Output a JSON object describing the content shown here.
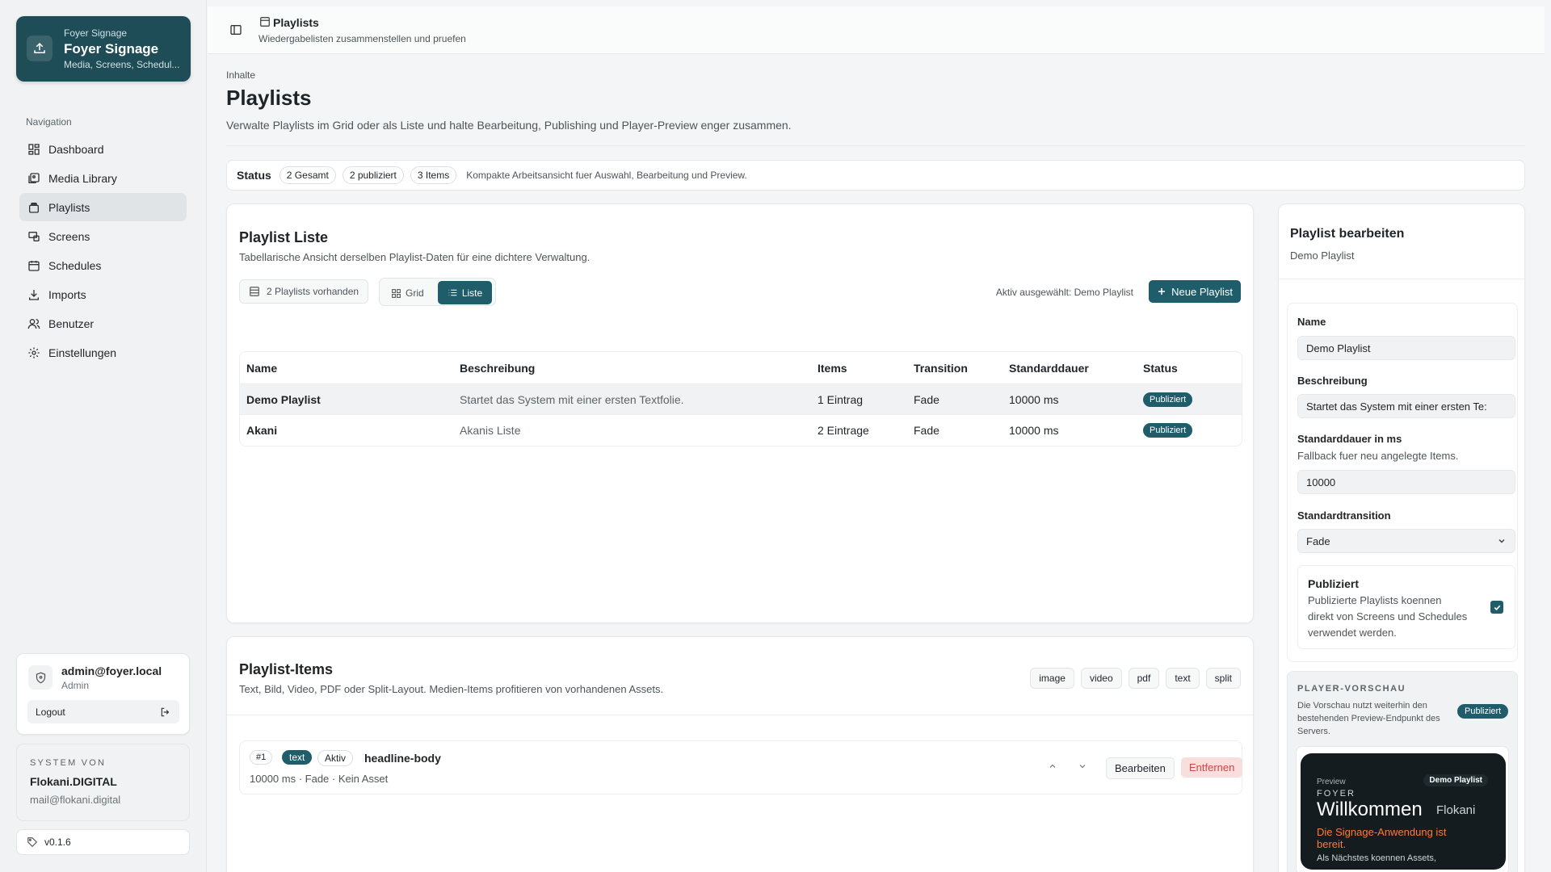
{
  "brand": {
    "small": "Foyer Signage",
    "title": "Foyer Signage",
    "subtitle": "Media, Screens, Schedul..."
  },
  "nav": {
    "label": "Navigation",
    "items": [
      {
        "label": "Dashboard",
        "icon": "dashboard-icon"
      },
      {
        "label": "Media Library",
        "icon": "media-icon"
      },
      {
        "label": "Playlists",
        "icon": "playlist-icon",
        "active": true
      },
      {
        "label": "Screens",
        "icon": "screens-icon"
      },
      {
        "label": "Schedules",
        "icon": "calendar-icon"
      },
      {
        "label": "Imports",
        "icon": "download-icon"
      },
      {
        "label": "Benutzer",
        "icon": "users-icon"
      },
      {
        "label": "Einstellungen",
        "icon": "gear-icon"
      }
    ]
  },
  "user": {
    "email": "admin@foyer.local",
    "role": "Admin",
    "logout": "Logout"
  },
  "system": {
    "label": "SYSTEM VON",
    "company": "Flokani.DIGITAL",
    "mail": "mail@flokani.digital"
  },
  "version": "v0.1.6",
  "header": {
    "title": "Playlists",
    "subtitle": "Wiedergabelisten zusammenstellen und pruefen"
  },
  "page": {
    "breadcrumb": "Inhalte",
    "title": "Playlists",
    "description": "Verwalte Playlists im Grid oder als Liste und halte Bearbeitung, Publishing und Player-Preview enger zusammen."
  },
  "status": {
    "label": "Status",
    "pills": [
      "2 Gesamt",
      "2 publiziert",
      "3 Items"
    ],
    "note": "Kompakte Arbeitsansicht fuer Auswahl, Bearbeitung und Preview."
  },
  "list": {
    "title": "Playlist Liste",
    "description": "Tabellarische Ansicht derselben Playlist-Daten für eine dichtere Verwaltung.",
    "count": "2 Playlists vorhanden",
    "view_grid": "Grid",
    "view_list": "Liste",
    "active_selected": "Aktiv ausgewählt: Demo Playlist",
    "new_button": "Neue Playlist",
    "columns": [
      "Name",
      "Beschreibung",
      "Items",
      "Transition",
      "Standarddauer",
      "Status"
    ],
    "rows": [
      {
        "name": "Demo Playlist",
        "description": "Startet das System mit einer ersten Textfolie.",
        "items": "1 Eintrag",
        "transition": "Fade",
        "duration": "10000 ms",
        "status": "Publiziert"
      },
      {
        "name": "Akani",
        "description": "Akanis Liste",
        "items": "2 Eintrage",
        "transition": "Fade",
        "duration": "10000 ms",
        "status": "Publiziert"
      }
    ]
  },
  "items": {
    "title": "Playlist-Items",
    "description": "Text, Bild, Video, PDF oder Split-Layout. Medien-Items profitieren von vorhandenen Assets.",
    "types": [
      "image",
      "video",
      "pdf",
      "text",
      "split"
    ],
    "rows": [
      {
        "num": "#1",
        "type": "text",
        "state": "Aktiv",
        "name": "headline-body",
        "meta": "10000 ms · Fade · Kein Asset",
        "edit": "Bearbeiten",
        "remove": "Entfernen"
      }
    ]
  },
  "editor": {
    "title": "Playlist bearbeiten",
    "subtitle": "Demo Playlist",
    "name_label": "Name",
    "name_value": "Demo Playlist",
    "desc_label": "Beschreibung",
    "desc_value": "Startet das System mit einer ersten Te:",
    "duration_label": "Standarddauer in ms",
    "duration_hint": "Fallback fuer neu angelegte Items.",
    "duration_value": "10000",
    "transition_label": "Standardtransition",
    "transition_value": "Fade",
    "published_title": "Publiziert",
    "published_desc": "Publizierte Playlists koennen direkt von Screens und Schedules verwendet werden.",
    "published_checked": true
  },
  "preview": {
    "label": "PLAYER-VORSCHAU",
    "note": "Die Vorschau nutzt weiterhin den bestehenden Preview-Endpunkt des Servers.",
    "badge": "Publiziert",
    "screen": {
      "preview": "Preview",
      "playlist": "Demo Playlist",
      "foyer": "FOYER",
      "welcome": "Willkommen",
      "brand": "Flokani",
      "ready": "Die Signage-Anwendung ist bereit.",
      "next": "Als Nächstes koennen Assets,"
    }
  },
  "colors": {
    "accent": "#1f5d6b",
    "brand_bg": "#1f4d57",
    "danger": "#d04545",
    "danger_bg": "#f9dede",
    "preview_orange": "#ff7a3a"
  }
}
